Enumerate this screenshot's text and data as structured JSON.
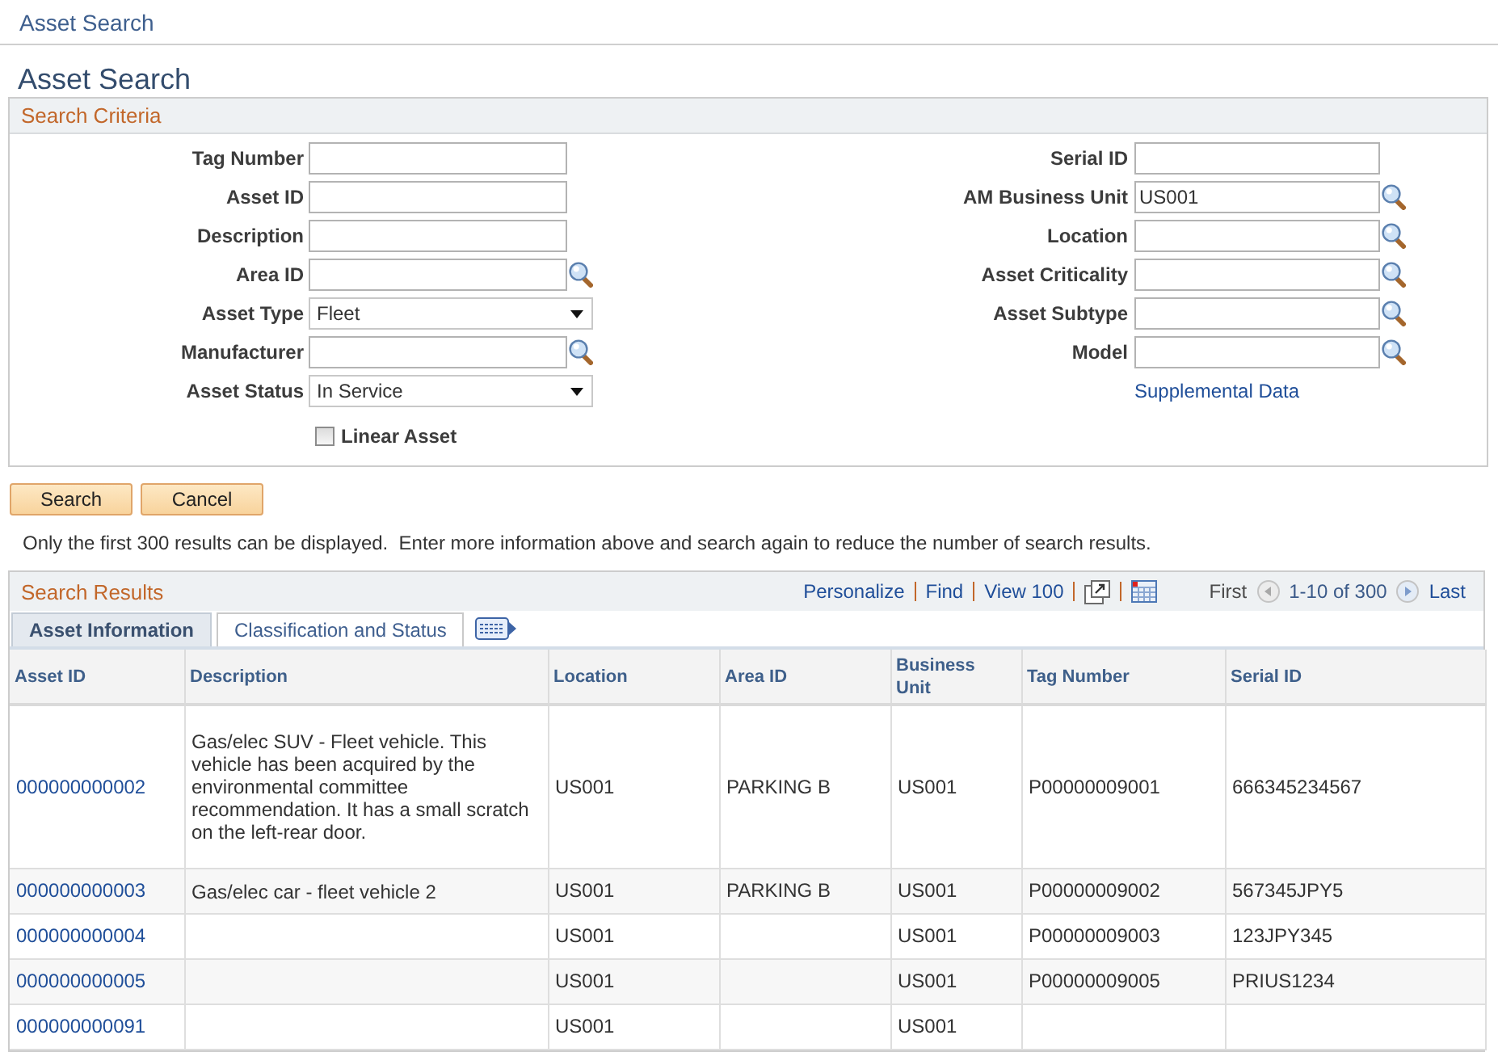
{
  "breadcrumb": "Asset Search",
  "page_title": "Asset Search",
  "search_criteria": {
    "title": "Search Criteria",
    "left_fields": [
      {
        "label": "Tag Number",
        "kind": "text"
      },
      {
        "label": "Asset ID",
        "kind": "text"
      },
      {
        "label": "Description",
        "kind": "text"
      },
      {
        "label": "Area ID",
        "kind": "lookup"
      },
      {
        "label": "Asset Type",
        "kind": "select",
        "value": "Fleet"
      },
      {
        "label": "Manufacturer",
        "kind": "lookup"
      },
      {
        "label": "Asset Status",
        "kind": "select",
        "value": "In Service"
      }
    ],
    "linear_asset": {
      "label": "Linear Asset",
      "checked": false
    },
    "right_fields": [
      {
        "label": "Serial ID",
        "kind": "text"
      },
      {
        "label": "AM Business Unit",
        "kind": "lookup",
        "value": "US001"
      },
      {
        "label": "Location",
        "kind": "lookup"
      },
      {
        "label": "Asset Criticality",
        "kind": "lookup"
      },
      {
        "label": "Asset Subtype",
        "kind": "lookup"
      },
      {
        "label": "Model",
        "kind": "lookup"
      }
    ],
    "supplemental_link": "Supplemental Data"
  },
  "buttons": [
    "Search",
    "Cancel"
  ],
  "notice": "Only the first 300 results can be displayed.  Enter more information above and search again to reduce the number of search results.",
  "search_results": {
    "title": "Search Results",
    "toolbar_links": [
      "Personalize",
      "Find",
      "View 100"
    ],
    "pager": {
      "first": {
        "label": "First",
        "disabled": true
      },
      "range": "1-10 of 300",
      "last": {
        "label": "Last",
        "disabled": false
      }
    },
    "tabs": [
      {
        "label": "Asset Information",
        "selected": true
      },
      {
        "label": "Classification and Status",
        "selected": false
      }
    ],
    "columns": [
      "Asset ID",
      "Description",
      "Location",
      "Area ID",
      "Business Unit",
      "Tag Number",
      "Serial ID"
    ],
    "rows": [
      {
        "asset_id": "000000000002",
        "description": "Gas/elec SUV - Fleet vehicle. This vehicle has been acquired by the environmental committee recommendation. It has a small scratch on the left-rear door.",
        "location": "US001",
        "area_id": "PARKING B",
        "business_unit": "US001",
        "tag_number": "P00000009001",
        "serial_id": "666345234567"
      },
      {
        "asset_id": "000000000003",
        "description": "Gas/elec car - fleet vehicle 2",
        "location": "US001",
        "area_id": "PARKING B",
        "business_unit": "US001",
        "tag_number": "P00000009002",
        "serial_id": "567345JPY5"
      },
      {
        "asset_id": "000000000004",
        "location": "US001",
        "business_unit": "US001",
        "tag_number": "P00000009003",
        "serial_id": "123JPY345"
      },
      {
        "asset_id": "000000000005",
        "location": "US001",
        "business_unit": "US001",
        "tag_number": "P00000009005",
        "serial_id": "PRIUS1234"
      },
      {
        "asset_id": "000000000091",
        "location": "US001",
        "business_unit": "US001"
      }
    ]
  }
}
